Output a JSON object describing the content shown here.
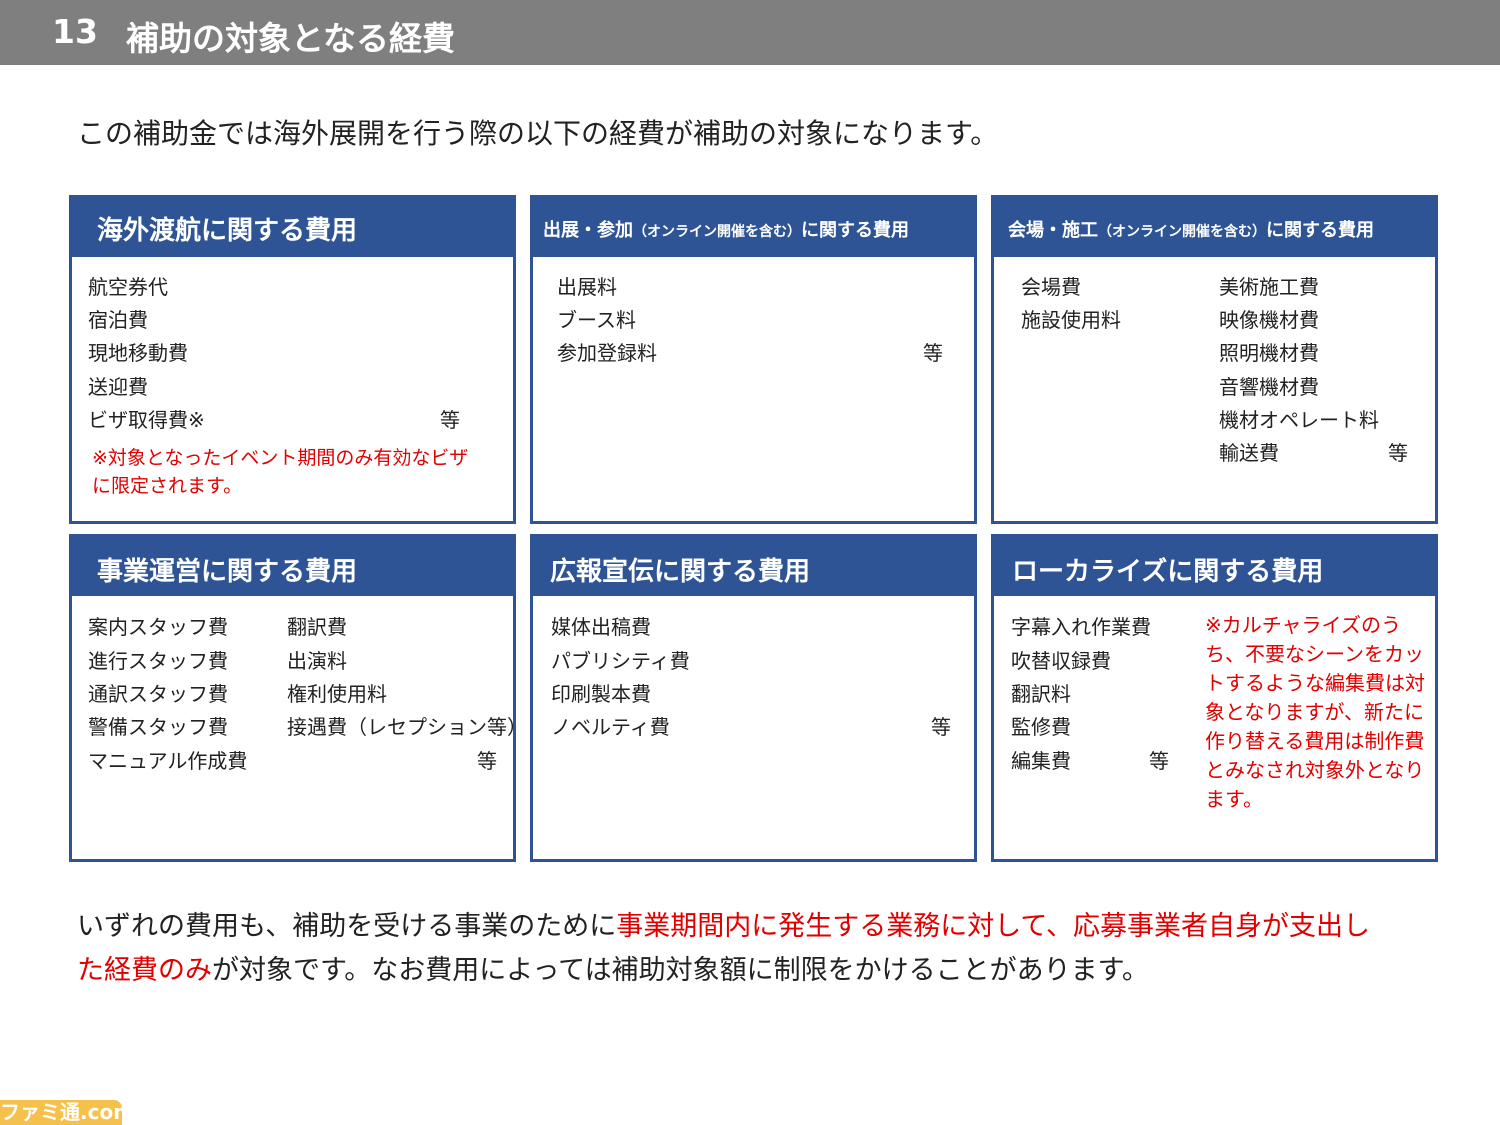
{
  "header": {
    "number": "13",
    "title": "補助の対象となる経費"
  },
  "intro": "この補助金では海外展開を行う際の以下の経費が補助の対象になります。",
  "cards": {
    "travel": {
      "title": "海外渡航に関する費用",
      "items": [
        "航空券代",
        "宿泊費",
        "現地移動費",
        "送迎費",
        "ビザ取得費※"
      ],
      "etc": "等",
      "note": "※対象となったイベント期間のみ有効なビザに限定されます。"
    },
    "exhibit": {
      "title_main": "出展・参加",
      "title_paren": "（オンライン開催を含む）",
      "title_tail": "に関する費用",
      "items": [
        "出展料",
        "ブース料",
        "参加登録料"
      ],
      "etc": "等"
    },
    "venue": {
      "title_main": "会場・施工",
      "title_paren": "（オンライン開催を含む）",
      "title_tail": "に関する費用",
      "col1": [
        "会場費",
        "施設使用料"
      ],
      "col2": [
        "美術施工費",
        "映像機材費",
        "照明機材費",
        "音響機材費",
        "機材オペレート料",
        "輸送費"
      ],
      "etc": "等"
    },
    "operation": {
      "title": "事業運営に関する費用",
      "col1": [
        "案内スタッフ費",
        "進行スタッフ費",
        "通訳スタッフ費",
        "警備スタッフ費",
        "マニュアル作成費"
      ],
      "col2": [
        "翻訳費",
        "出演料",
        "権利使用料",
        "接遇費（レセプション等）"
      ],
      "etc": "等"
    },
    "pr": {
      "title": "広報宣伝に関する費用",
      "items": [
        "媒体出稿費",
        "パブリシティ費",
        "印刷製本費",
        "ノベルティ費"
      ],
      "etc": "等"
    },
    "localize": {
      "title": "ローカライズに関する費用",
      "items": [
        "字幕入れ作業費",
        "吹替収録費",
        "翻訳料",
        "監修費",
        "編集費"
      ],
      "etc": "等",
      "note": "※カルチャライズのうち、不要なシーンをカットするような編集費は対象となりますが、新たに作り替える費用は制作費とみなされ対象外となります。"
    }
  },
  "footer": {
    "part1": "いずれの費用も、補助を受ける事業のために",
    "part2_red": "事業期間内に発生する業務に対して、応募事業者自身が支出した経費のみ",
    "part3": "が対象です。なお費用によっては補助対象額に制限をかけることがあります。"
  },
  "watermark": "ファミ通.com",
  "colors": {
    "header_gray": "#7f7f7f",
    "card_blue": "#2e5496",
    "emphasis_red": "#e00000",
    "logo_yellow": "#f5c14b"
  }
}
